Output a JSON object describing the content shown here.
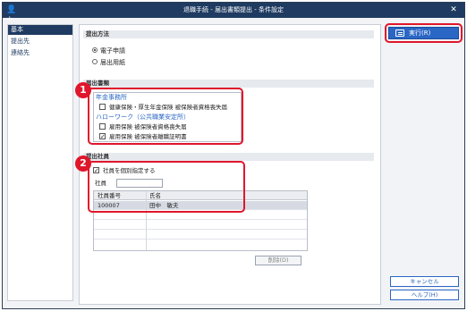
{
  "window": {
    "title": "退職手続 - 届出書類提出 - 条件設定"
  },
  "sidebar": {
    "items": [
      {
        "label": "基本"
      },
      {
        "label": "提出先"
      },
      {
        "label": "連絡先"
      }
    ]
  },
  "submission_method": {
    "heading": "提出方法",
    "options": [
      {
        "label": "電子申請",
        "selected": true
      },
      {
        "label": "届出用紙",
        "selected": false
      }
    ]
  },
  "documents": {
    "heading": "届出書類",
    "groups": [
      {
        "label": "年金事務所",
        "items": [
          {
            "label": "健康保険・厚生年金保険 被保険者資格喪失届",
            "checked": false
          }
        ]
      },
      {
        "label": "ハローワーク（公共職業安定所）",
        "items": [
          {
            "label": "雇用保険 被保険者資格喪失届",
            "checked": false
          },
          {
            "label": "雇用保険 被保険者離職証明書",
            "checked": true
          }
        ]
      }
    ]
  },
  "employees": {
    "heading": "提出社員",
    "individual_label": "社員を個別指定する",
    "individual_checked": true,
    "employee_label": "社員",
    "employee_value": "",
    "columns": [
      "社員番号",
      "氏名"
    ],
    "rows": [
      {
        "number": "100007",
        "name": "田中　敏夫"
      }
    ],
    "delete_label": "削除(D)"
  },
  "actions": {
    "execute": "実行(R)",
    "cancel": "キャンセル",
    "help": "ヘルプ(H)"
  },
  "annotations": {
    "badge_1": "1",
    "badge_2": "2"
  },
  "colors": {
    "titlebar": "#1f3b61",
    "accent": "#2a66c4",
    "highlight": "#e0162b"
  }
}
